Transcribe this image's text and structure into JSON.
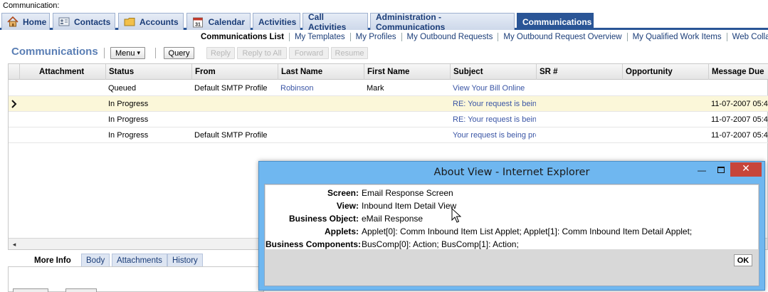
{
  "topbar": {
    "label": "Communication:"
  },
  "screen_tabs": [
    {
      "label": "Home",
      "icon": "home-icon"
    },
    {
      "label": "Contacts",
      "icon": "contacts-card-icon"
    },
    {
      "label": "Accounts",
      "icon": "folder-icon"
    },
    {
      "label": "Calendar",
      "icon": "calendar-icon",
      "icon_text": "31"
    },
    {
      "label": "Activities"
    },
    {
      "label": "Call Activities"
    },
    {
      "label": "Administration - Communications"
    },
    {
      "label": "Communications",
      "active": true
    }
  ],
  "subnav": [
    {
      "label": "Communications List",
      "current": true
    },
    {
      "label": "My Templates"
    },
    {
      "label": "My Profiles"
    },
    {
      "label": "My Outbound Requests"
    },
    {
      "label": "My Outbound Request Overview"
    },
    {
      "label": "My Qualified Work Items"
    },
    {
      "label": "Web Collaborat"
    }
  ],
  "applet": {
    "title": "Communications",
    "menu_label": "Menu",
    "menu_arrow": "▾",
    "query_label": "Query",
    "reply_label": "Reply",
    "reply_all_label": "Reply to All",
    "forward_label": "Forward",
    "resume_label": "Resume"
  },
  "list": {
    "columns": [
      "Attachment",
      "Status",
      "From",
      "Last Name",
      "First Name",
      "Subject",
      "SR #",
      "Opportunity",
      "Message Due"
    ],
    "rows": [
      {
        "attachment": "",
        "status": "Queued",
        "from": "Default SMTP Profile",
        "last_name": "Robinson",
        "first_name": "Mark",
        "subject": "View Your Bill Online",
        "sr": "",
        "opportunity": "",
        "due": ""
      },
      {
        "attachment": "",
        "status": "In Progress",
        "from": "",
        "last_name": "",
        "first_name": "",
        "subject": "RE: Your request is bein",
        "sr": "",
        "opportunity": "",
        "due": "11-07-2007 05:4",
        "selected": true
      },
      {
        "attachment": "",
        "status": "In Progress",
        "from": "",
        "last_name": "",
        "first_name": "",
        "subject": "RE: Your request is bein",
        "sr": "",
        "opportunity": "",
        "due": "11-07-2007 05:4"
      },
      {
        "attachment": "",
        "status": "In Progress",
        "from": "Default SMTP Profile",
        "last_name": "",
        "first_name": "",
        "subject": "Your request is being pro",
        "sr": "",
        "opportunity": "",
        "due": "11-07-2007 05:4"
      }
    ],
    "scroll_left_glyph": "◂"
  },
  "form_tabs": [
    {
      "label": "More Info",
      "active": true
    },
    {
      "label": "Body"
    },
    {
      "label": "Attachments"
    },
    {
      "label": "History"
    }
  ],
  "dialog": {
    "title": "About View - Internet Explorer",
    "minimize_glyph": "—",
    "close_glyph": "✕",
    "rows": [
      {
        "label": "Screen:",
        "value": "Email Response Screen"
      },
      {
        "label": "View:",
        "value": "Inbound Item Detail View"
      },
      {
        "label": "Business Object:",
        "value": "eMail Response"
      },
      {
        "label": "Applets:",
        "value": "Applet[0]: Comm Inbound Item List Applet; Applet[1]: Comm Inbound Item Detail Applet;"
      },
      {
        "label": "Business Components:",
        "value": "BusComp[0]: Action; BusComp[1]: Action;"
      }
    ],
    "ok_label": "OK"
  },
  "colors": {
    "tab_active": "#2a5596",
    "link": "#3a55a5",
    "selected_row": "#fbf7d9",
    "dialog_frame": "#6fb7f0",
    "close_button": "#c7453a"
  }
}
